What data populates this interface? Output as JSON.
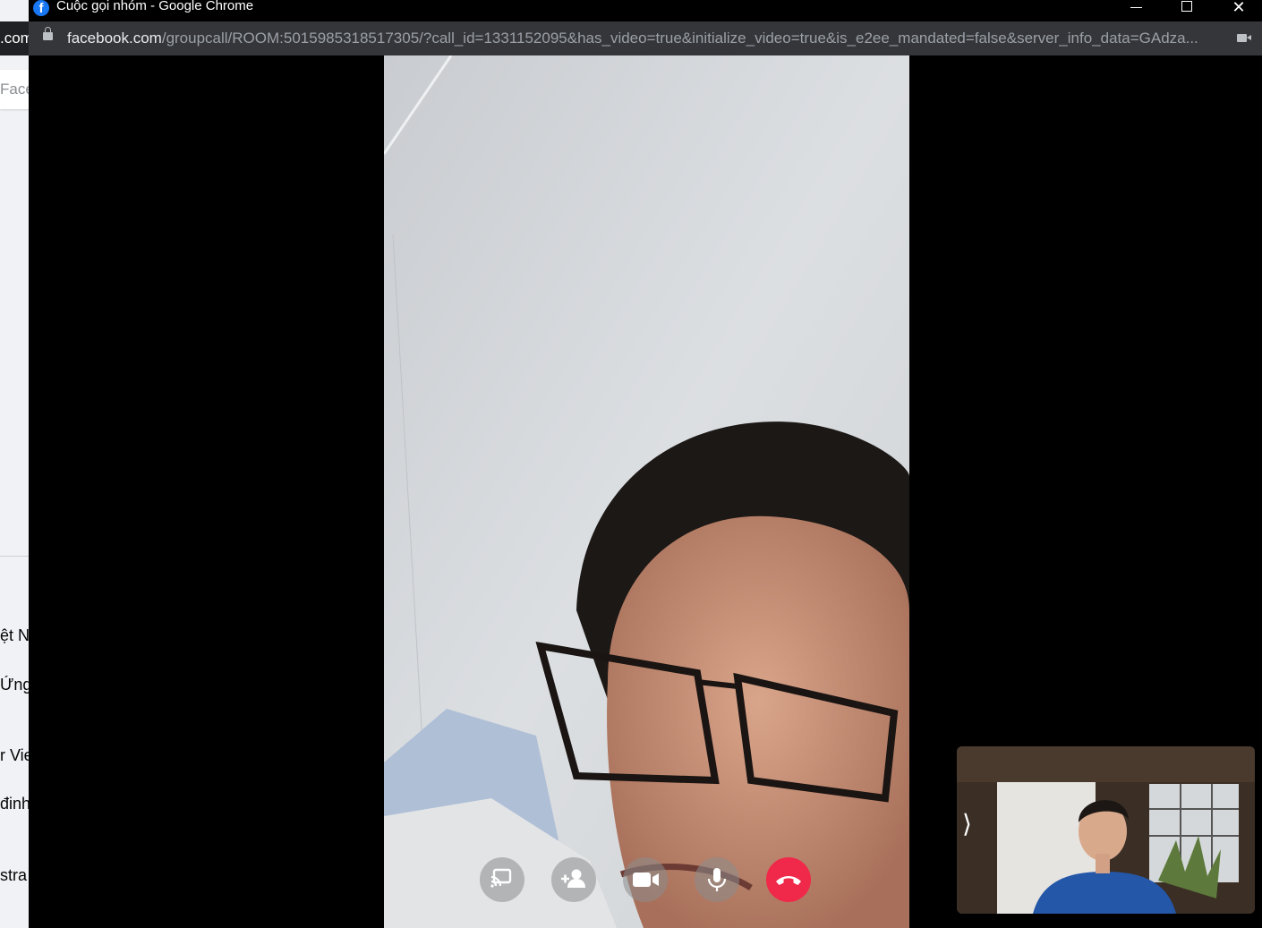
{
  "background_window": {
    "address_fragment": ".com",
    "search_fragment": "Face",
    "items": [
      "ệt N",
      "Ứng",
      "r Vie",
      "đinh",
      "stra"
    ]
  },
  "window": {
    "title": "Cuộc gọi nhóm - Google Chrome",
    "icon": "facebook-icon"
  },
  "address_bar": {
    "host": "facebook.com",
    "path": "/groupcall/ROOM:5015985318517305/?call_id=1331152095&has_video=true&initialize_video=true&is_e2ee_mandated=false&server_info_data=GAdza..."
  },
  "controls": [
    {
      "name": "screen-share-button",
      "icon": "screen-share-icon"
    },
    {
      "name": "add-participant-button",
      "icon": "add-person-icon"
    },
    {
      "name": "camera-toggle-button",
      "icon": "video-camera-icon"
    },
    {
      "name": "mic-toggle-button",
      "icon": "microphone-icon"
    },
    {
      "name": "end-call-button",
      "icon": "hang-up-icon",
      "color": "#f02849"
    }
  ],
  "self_view": {
    "expand_glyph": "⟩"
  }
}
